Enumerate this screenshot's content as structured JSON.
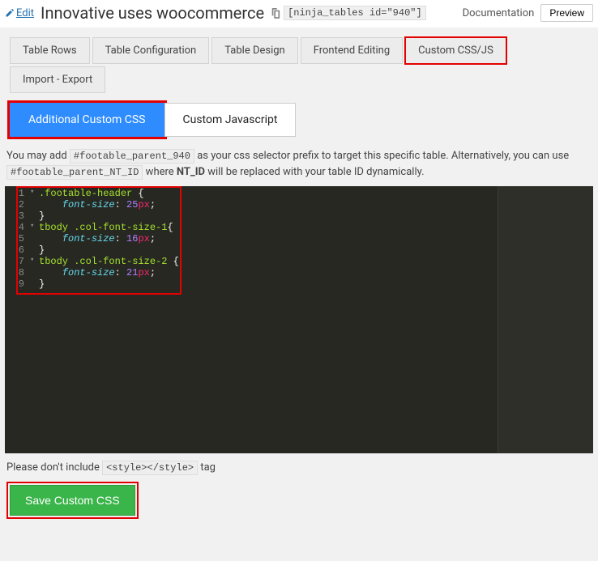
{
  "header": {
    "edit_label": "Edit",
    "title": "Innovative uses woocommerce",
    "shortcode": "[ninja_tables id=\"940\"]",
    "documentation_label": "Documentation",
    "preview_label": "Preview"
  },
  "tabs": [
    {
      "label": "Table Rows"
    },
    {
      "label": "Table Configuration"
    },
    {
      "label": "Table Design"
    },
    {
      "label": "Frontend Editing"
    },
    {
      "label": "Custom CSS/JS",
      "highlighted": true
    },
    {
      "label": "Import - Export"
    }
  ],
  "subtabs": [
    {
      "label": "Additional Custom CSS",
      "active": true,
      "highlighted": true
    },
    {
      "label": "Custom Javascript"
    }
  ],
  "help": {
    "prefix_text_a": "You may add ",
    "selector1": "#footable_parent_940",
    "prefix_text_b": " as your css selector prefix to target this specific table. Alternatively, you can use ",
    "selector2": "#footable_parent_NT_ID",
    "prefix_text_c": " where ",
    "nt_id": "NT_ID",
    "prefix_text_d": " will be replaced with your table ID dynamically."
  },
  "editor": {
    "lines": [
      ".footable-header {",
      "    font-size: 25px;",
      "}",
      "tbody .col-font-size-1{",
      "    font-size: 16px;",
      "}",
      "tbody .col-font-size-2 {",
      "    font-size: 21px;",
      "}"
    ],
    "line_numbers": [
      "1",
      "2",
      "3",
      "4",
      "5",
      "6",
      "7",
      "8",
      "9"
    ]
  },
  "note": {
    "pre": "Please don't include ",
    "code": "<style></style>",
    "post": " tag"
  },
  "save_label": "Save Custom CSS"
}
